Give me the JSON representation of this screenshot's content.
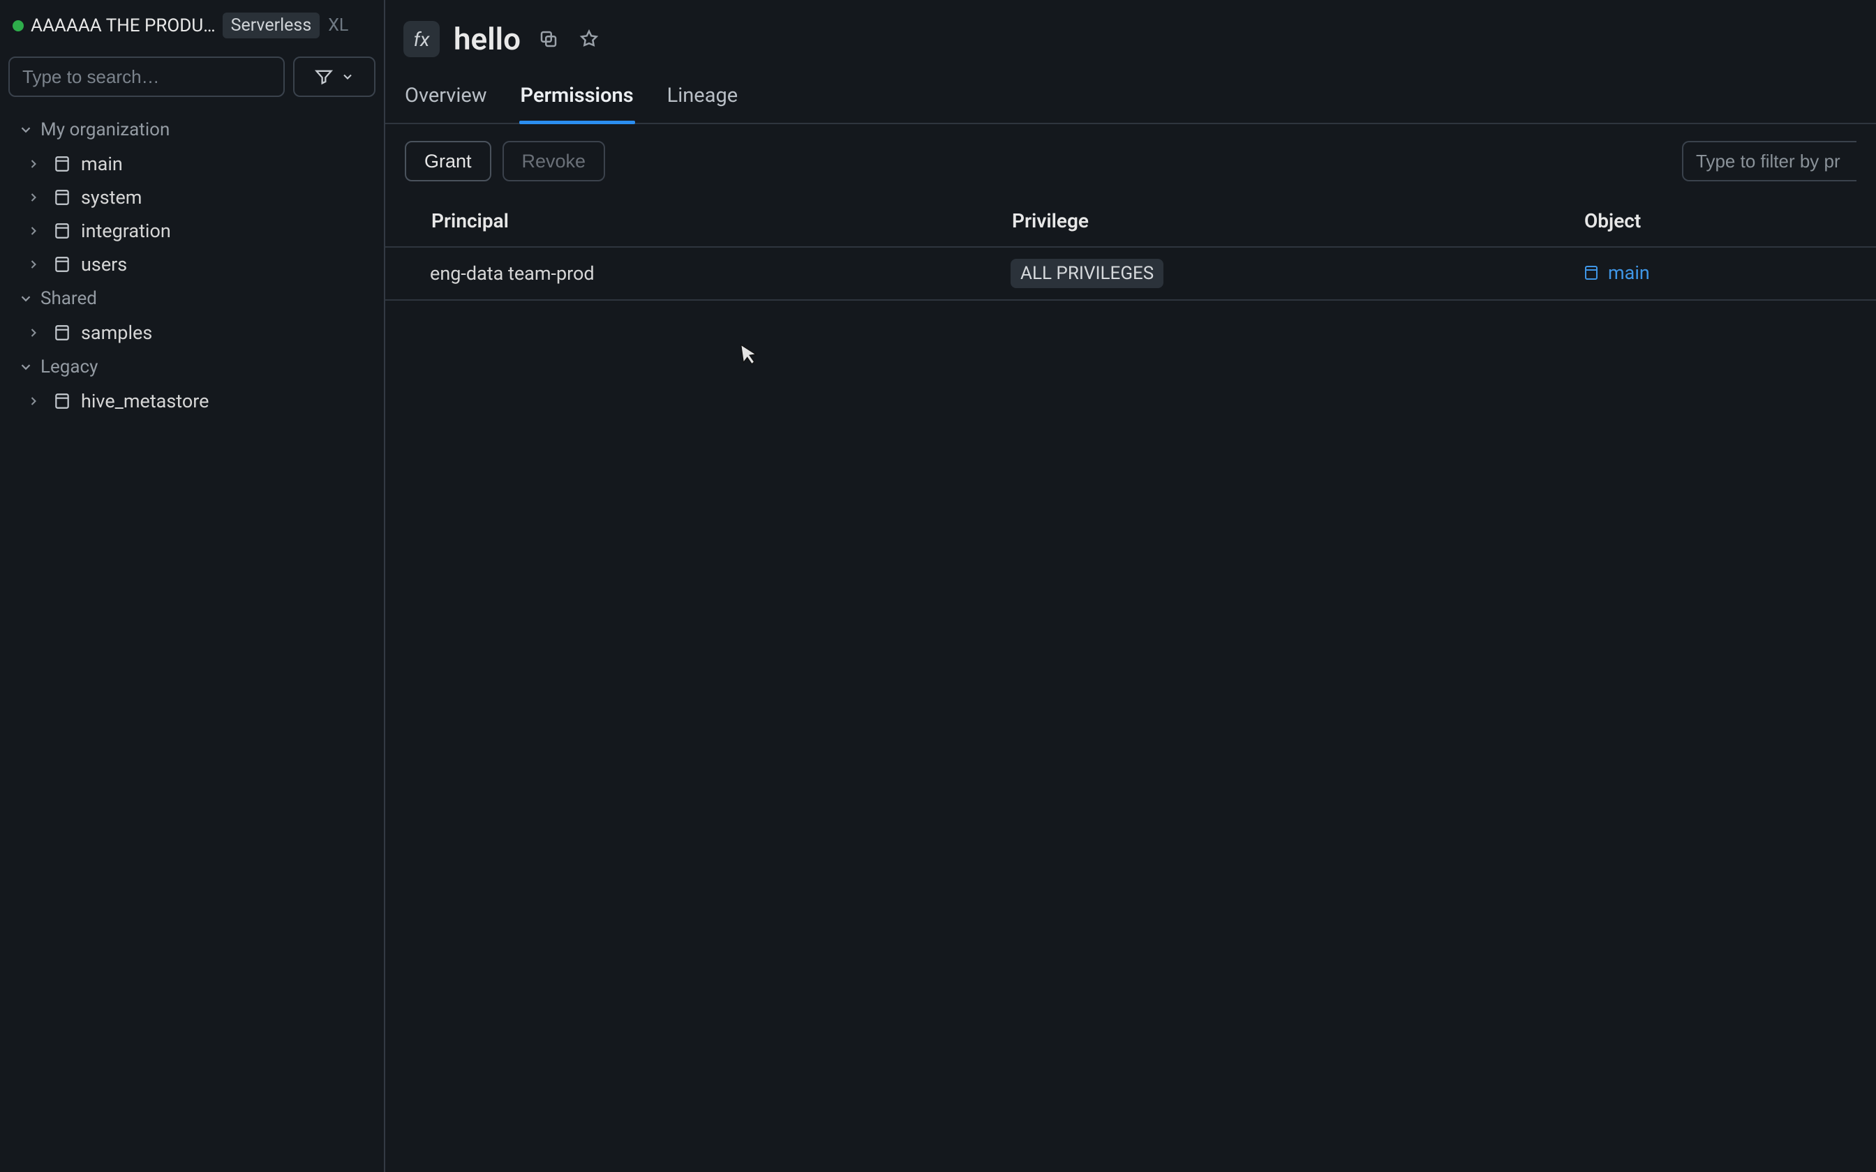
{
  "workspace": {
    "name": "AAAAAA THE PRODU…",
    "badge": "Serverless",
    "size": "XL"
  },
  "search": {
    "placeholder": "Type to search…"
  },
  "sidebar": {
    "groups": [
      {
        "label": "My organization",
        "items": [
          "main",
          "system",
          "integration",
          "users"
        ]
      },
      {
        "label": "Shared",
        "items": [
          "samples"
        ]
      },
      {
        "label": "Legacy",
        "items": [
          "hive_metastore"
        ]
      }
    ]
  },
  "header": {
    "fx": "fx",
    "title": "hello"
  },
  "tabs": {
    "overview": "Overview",
    "permissions": "Permissions",
    "lineage": "Lineage",
    "active": "permissions"
  },
  "toolbar": {
    "grant": "Grant",
    "revoke": "Revoke",
    "filter_placeholder": "Type to filter by pr"
  },
  "table": {
    "headers": {
      "principal": "Principal",
      "privilege": "Privilege",
      "object": "Object"
    },
    "rows": [
      {
        "principal": "eng-data team-prod",
        "privilege": "ALL PRIVILEGES",
        "object": "main"
      }
    ]
  },
  "colors": {
    "accent": "#2b8ef0",
    "status_green": "#2ead4b",
    "link": "#3f96e6"
  }
}
